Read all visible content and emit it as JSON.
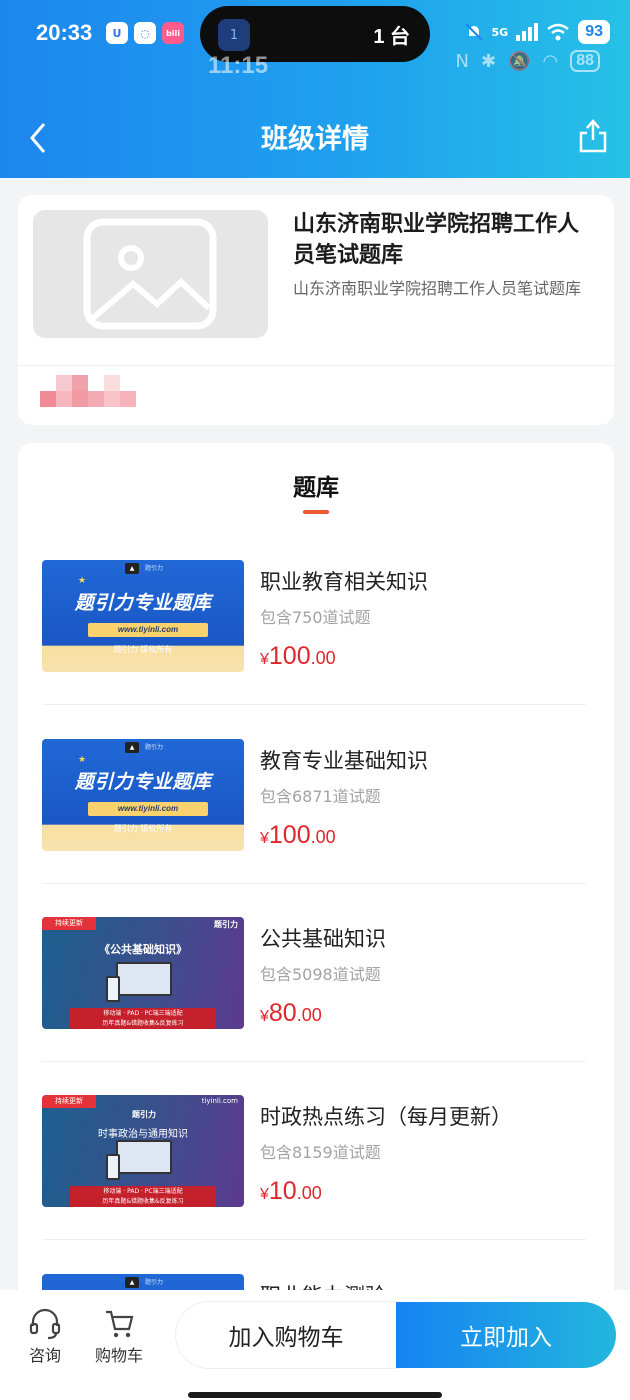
{
  "status_bar": {
    "time": "20:33",
    "app_icons": [
      "U",
      "◌",
      "bili"
    ],
    "cast_count": "1 台",
    "cast_badge": "1",
    "network": "5G",
    "battery": "93",
    "ghost_time": "11:15",
    "ghost_battery": "88"
  },
  "nav": {
    "title": "班级详情",
    "back_icon": "chevron-left-icon",
    "share_icon": "share-icon"
  },
  "class_info": {
    "title": "山东济南职业学院招聘工作人员笔试题库",
    "subtitle": "山东济南职业学院招聘工作人员笔试题库",
    "mosaic_colors": [
      "#ffffff",
      "#f5c9cf",
      "#f0a2ab",
      "#ffffff",
      "#fbdde0",
      "#ffffff",
      "#f08a95",
      "#f7b7be",
      "#f29aa3",
      "#f4aab2",
      "#f8c4ca",
      "#f6b3ba"
    ]
  },
  "question_bank": {
    "section_title": "题库",
    "currency": "¥",
    "items": [
      {
        "name": "职业教育相关知识",
        "count": "包含750道试题",
        "price_int": "100",
        "price_dec": ".00",
        "thumb": "blue"
      },
      {
        "name": "教育专业基础知识",
        "count": "包含6871道试题",
        "price_int": "100",
        "price_dec": ".00",
        "thumb": "blue"
      },
      {
        "name": "公共基础知识",
        "count": "包含5098道试题",
        "price_int": "80",
        "price_dec": ".00",
        "thumb": "purple"
      },
      {
        "name": "时政热点练习（每月更新）",
        "count": "包含8159道试题",
        "price_int": "10",
        "price_dec": ".00",
        "thumb": "purple"
      },
      {
        "name": "职业能力测验",
        "count": "",
        "price_int": "",
        "price_dec": "",
        "thumb": "blue"
      }
    ],
    "thumb_blue": {
      "logo": "题引力",
      "headline": "题引力专业题库",
      "url": "www.tiyinli.com",
      "rights": "题引力 版权所有"
    },
    "thumb_purple": {
      "tag": "持续更新",
      "brand": "题引力",
      "site": "tiyinli.com",
      "subjects": [
        "《公共基础知识》",
        "时事政治与通用知识"
      ],
      "banner_line1": "移动端 · PAD · PC端三端适配",
      "banner_line2": "历年真题&错题收集&反复练习"
    }
  },
  "bottom_bar": {
    "consult_label": "咨询",
    "cart_tab_label": "购物车",
    "add_cart_label": "加入购物车",
    "join_label": "立即加入"
  }
}
